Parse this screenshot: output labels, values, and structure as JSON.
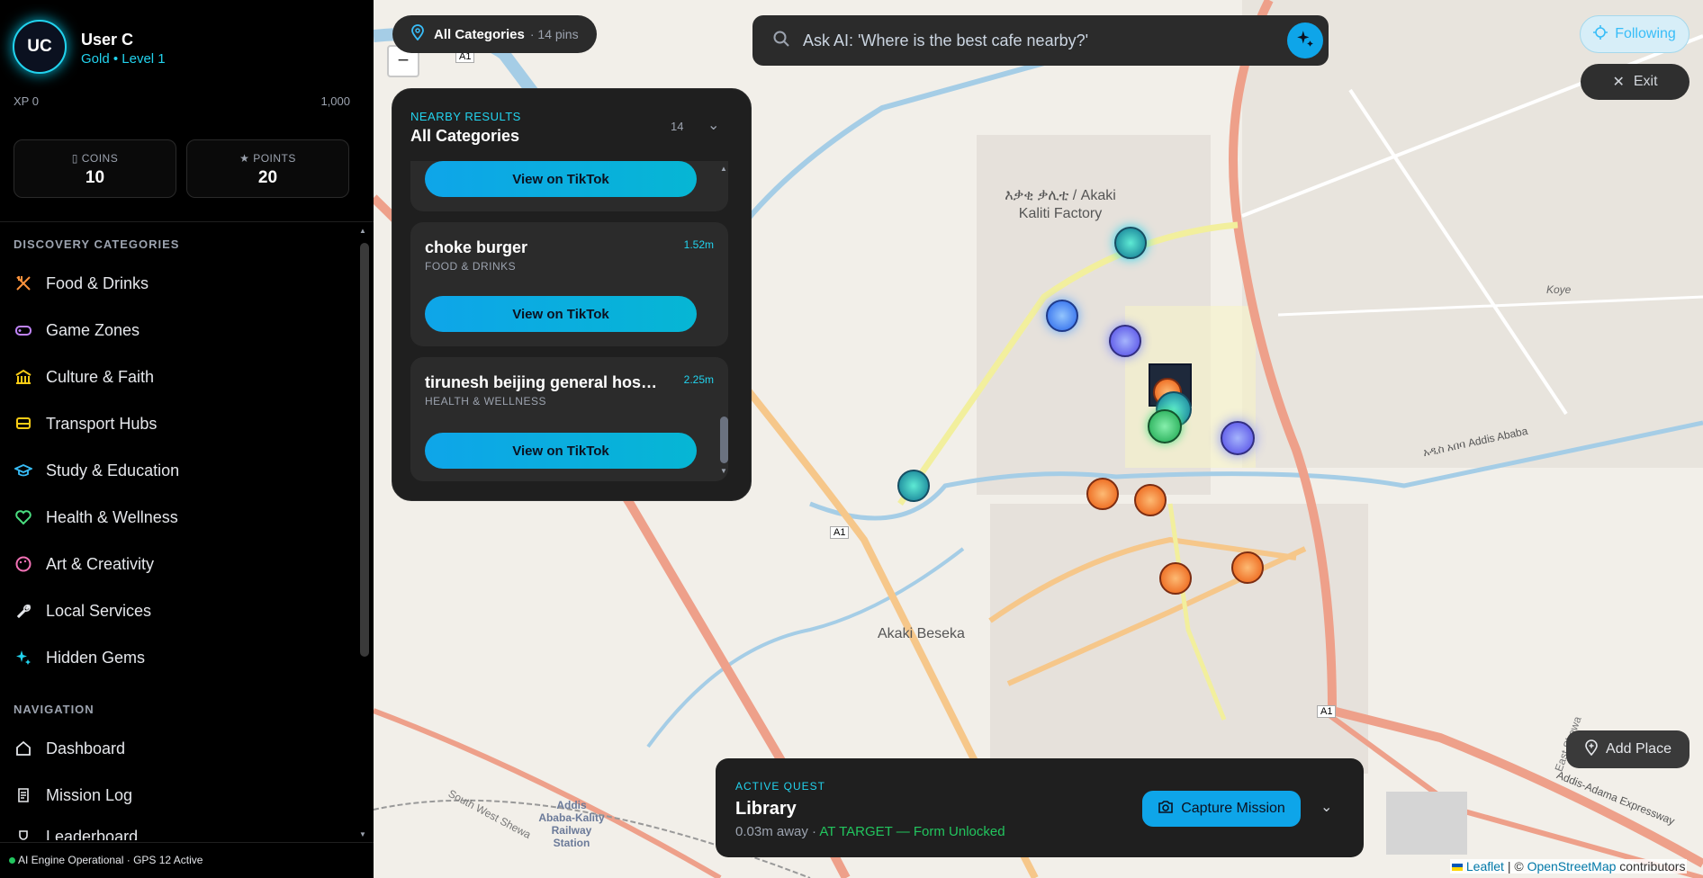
{
  "user": {
    "initials": "UC",
    "name": "User C",
    "rank": "Gold • Level 1",
    "xp_label": "XP 0",
    "xp_max": "1,000"
  },
  "stats": {
    "coins_label": "▯ COINS",
    "coins_value": "10",
    "points_label": "★ POINTS",
    "points_value": "20"
  },
  "sidebar": {
    "categories_title": "DISCOVERY CATEGORIES",
    "categories": [
      {
        "label": "Food & Drinks",
        "icon": "utensils-icon",
        "color": "#fb923c"
      },
      {
        "label": "Game Zones",
        "icon": "gamepad-icon",
        "color": "#c084fc"
      },
      {
        "label": "Culture & Faith",
        "icon": "landmark-icon",
        "color": "#facc15"
      },
      {
        "label": "Transport Hubs",
        "icon": "bus-icon",
        "color": "#facc15"
      },
      {
        "label": "Study & Education",
        "icon": "graduation-cap-icon",
        "color": "#38bdf8"
      },
      {
        "label": "Health & Wellness",
        "icon": "heart-pulse-icon",
        "color": "#4ade80"
      },
      {
        "label": "Art & Creativity",
        "icon": "palette-icon",
        "color": "#f472b6"
      },
      {
        "label": "Local Services",
        "icon": "wrench-icon",
        "color": "#e5e7eb"
      },
      {
        "label": "Hidden Gems",
        "icon": "sparkles-icon",
        "color": "#22d3ee"
      }
    ],
    "nav_title": "NAVIGATION",
    "nav": [
      {
        "label": "Dashboard",
        "icon": "home-icon"
      },
      {
        "label": "Mission Log",
        "icon": "scroll-icon"
      },
      {
        "label": "Leaderboard",
        "icon": "trophy-icon"
      }
    ],
    "status": "AI Engine Operational · GPS 12 Active"
  },
  "map": {
    "category_pill": "All Categories",
    "pins_count": "· 14 pins",
    "zoom_out": "−",
    "search_placeholder": "Ask AI: 'Where is the best cafe nearby?'",
    "following_label": "Following",
    "exit_label": "Exit",
    "add_place_label": "Add Place",
    "labels": {
      "factory": "እቃቂ ቃሊቲ / Akaki Kaliti Factory",
      "beseka": "Akaki Beseka",
      "koye": "Koye",
      "station": "Addis Ababa-Kality Railway Station",
      "road1": "A1",
      "road2": "A1",
      "road3": "A1",
      "road4": "አዲስ አበባ Addis Ababa",
      "shewa": "South West Shewa",
      "expressway": "Addis-Adama Expressway",
      "oromia": "East Shewa"
    },
    "attribution_leaflet": "Leaflet",
    "attribution_sep": " | © ",
    "attribution_osm": "OpenStreetMap",
    "attribution_tail": " contributors",
    "leaflet_flag_color": "#0057b7"
  },
  "results": {
    "kicker": "NEARBY RESULTS",
    "title": "All Categories",
    "count": "14",
    "button_label": "View on TikTok",
    "items": [
      {
        "name": "choke burger",
        "category": "FOOD & DRINKS",
        "distance": "1.52m"
      },
      {
        "name": "tirunesh beijing general hospi...",
        "category": "HEALTH & WELLNESS",
        "distance": "2.25m"
      }
    ]
  },
  "quest": {
    "kicker": "ACTIVE QUEST",
    "title": "Library",
    "distance": "0.03m away · ",
    "status": "AT TARGET — Form Unlocked",
    "capture_label": "Capture Mission"
  },
  "colors": {
    "accent": "#22d3ee",
    "primary": "#0ea5e9",
    "success": "#22c55e"
  }
}
